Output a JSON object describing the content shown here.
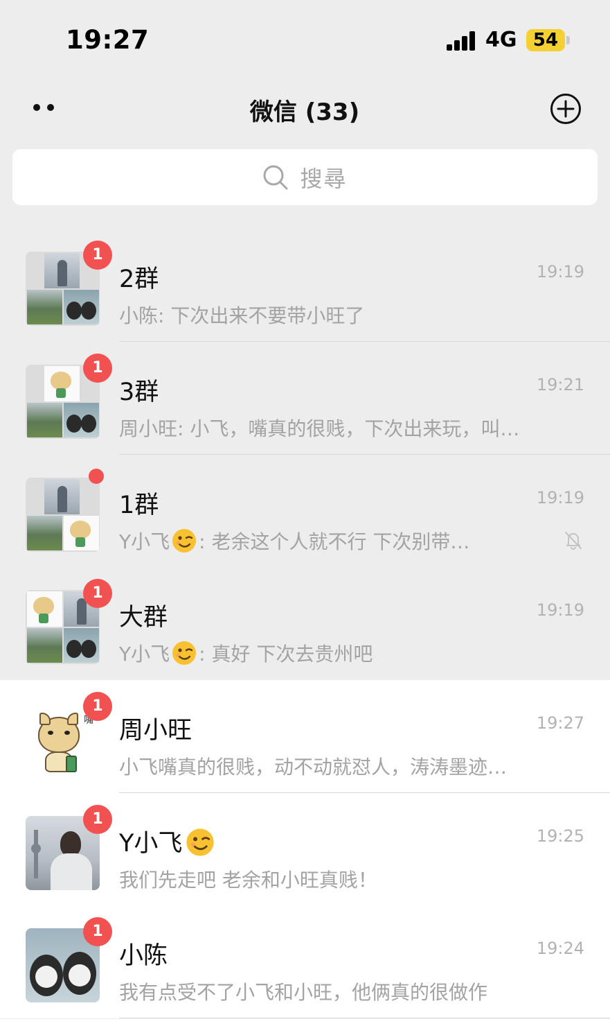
{
  "status": {
    "time": "19:27",
    "network": "4G",
    "battery": "54"
  },
  "header": {
    "title": "微信 (33)",
    "more_icon": "more-dots-icon",
    "add_icon": "plus-circle-icon"
  },
  "search": {
    "placeholder": "搜尋",
    "icon": "search-icon"
  },
  "colors": {
    "badge": "#f25152",
    "pinned_bg": "#ededed",
    "normal_bg": "#ffffff",
    "battery": "#f5d032"
  },
  "chats": [
    {
      "name": "2群",
      "time": "19:19",
      "preview": "小陈: 下次出来不要带小旺了",
      "badge": "1"
    },
    {
      "name": "3群",
      "time": "19:21",
      "preview": "周小旺: 小飞，嘴真的很贱，下次出来玩，叫…",
      "badge": "1"
    },
    {
      "name": "1群",
      "time": "19:19",
      "preview_prefix": "Y小飞",
      "preview_suffix": ": 老余这个人就不行  下次别带…",
      "muted": true
    },
    {
      "name": "大群",
      "time": "19:19",
      "preview_prefix": "Y小飞",
      "preview_suffix": ": 真好  下次去贵州吧",
      "badge": "1"
    },
    {
      "name": "周小旺",
      "time": "19:27",
      "preview": "小飞嘴真的很贱，动不动就怼人，涛涛墨迹…",
      "badge": "1"
    },
    {
      "name": "Y小飞",
      "time": "19:25",
      "preview": "我们先走吧 老余和小旺真贱！",
      "badge": "1"
    },
    {
      "name": "小陈",
      "time": "19:24",
      "preview": "我有点受不了小飞和小旺，他俩真的很做作",
      "badge": "1"
    }
  ]
}
